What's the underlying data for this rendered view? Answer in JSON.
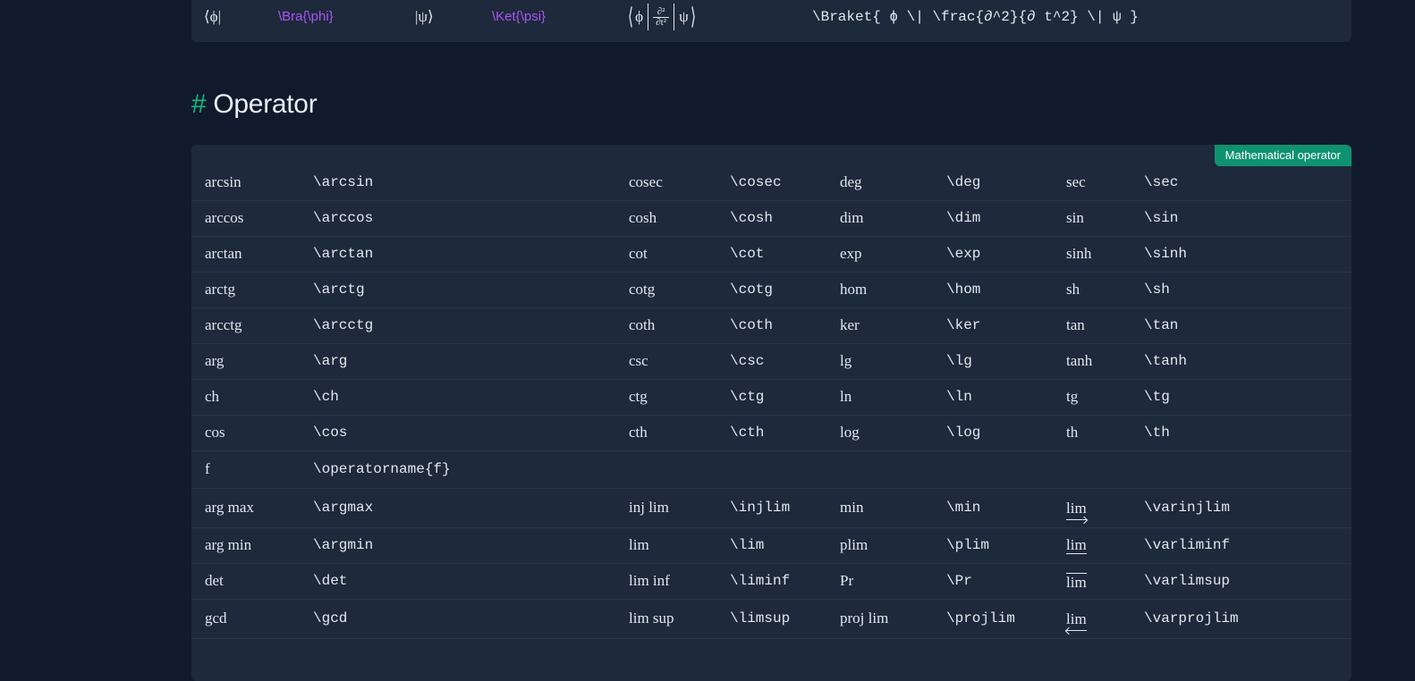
{
  "braket_row": {
    "bra_render": "⟨ϕ|",
    "bra_code": "\\Bra{\\phi}",
    "ket_render": "|ψ⟩",
    "ket_code": "\\Ket{\\psi}",
    "braket_render_phi": "ϕ",
    "braket_render_num": "∂²",
    "braket_render_den": "∂t²",
    "braket_render_psi": "ψ",
    "braket_code": "\\Braket{ ϕ \\| \\frac{∂^2}{∂ t^2} \\| ψ }"
  },
  "section": {
    "hash": "#",
    "title": "Operator",
    "badge": "Mathematical operator"
  },
  "colors": {
    "background": "#111a2c",
    "card": "#1e293b",
    "accent_green": "#10b981",
    "badge_bg": "#0e9270",
    "code_purple": "#a855f7"
  },
  "operators": [
    [
      "arcsin",
      "\\arcsin",
      "cosec",
      "\\cosec",
      "deg",
      "\\deg",
      "sec",
      "\\sec"
    ],
    [
      "arccos",
      "\\arccos",
      "cosh",
      "\\cosh",
      "dim",
      "\\dim",
      "sin",
      "\\sin"
    ],
    [
      "arctan",
      "\\arctan",
      "cot",
      "\\cot",
      "exp",
      "\\exp",
      "sinh",
      "\\sinh"
    ],
    [
      "arctg",
      "\\arctg",
      "cotg",
      "\\cotg",
      "hom",
      "\\hom",
      "sh",
      "\\sh"
    ],
    [
      "arcctg",
      "\\arcctg",
      "coth",
      "\\coth",
      "ker",
      "\\ker",
      "tan",
      "\\tan"
    ],
    [
      "arg",
      "\\arg",
      "csc",
      "\\csc",
      "lg",
      "\\lg",
      "tanh",
      "\\tanh"
    ],
    [
      "ch",
      "\\ch",
      "ctg",
      "\\ctg",
      "ln",
      "\\ln",
      "tg",
      "\\tg"
    ],
    [
      "cos",
      "\\cos",
      "cth",
      "\\cth",
      "log",
      "\\log",
      "th",
      "\\th"
    ],
    [
      "f",
      "\\operatorname{f}",
      "",
      "",
      "",
      "",
      "",
      ""
    ],
    [
      "arg max",
      "\\argmax",
      "inj lim",
      "\\injlim",
      "min",
      "\\min",
      "lim",
      "\\varinjlim"
    ],
    [
      "arg min",
      "\\argmin",
      "lim",
      "\\lim",
      "plim",
      "\\plim",
      "lim",
      "\\varliminf"
    ],
    [
      "det",
      "\\det",
      "lim inf",
      "\\liminf",
      "Pr",
      "\\Pr",
      "lim",
      "\\varlimsup"
    ],
    [
      "gcd",
      "\\gcd",
      "lim sup",
      "\\limsup",
      "proj lim",
      "\\projlim",
      "lim",
      "\\varprojlim"
    ]
  ]
}
